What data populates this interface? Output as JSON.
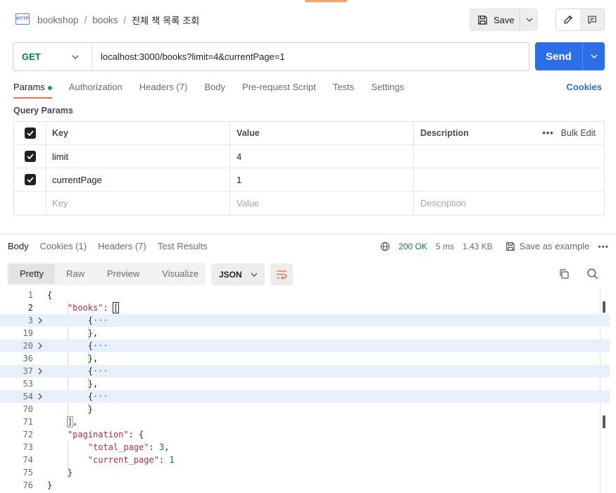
{
  "breadcrumb": {
    "icon_text": "HTTP",
    "items": [
      "bookshop",
      "books"
    ],
    "current": "전체 책 목록 조회"
  },
  "toolbar": {
    "save_label": "Save"
  },
  "request": {
    "method": "GET",
    "url": "localhost:3000/books?limit=4&currentPage=1",
    "send_label": "Send"
  },
  "request_tabs": [
    "Params",
    "Authorization",
    "Headers (7)",
    "Body",
    "Pre-request Script",
    "Tests",
    "Settings"
  ],
  "cookies_label": "Cookies",
  "query_params": {
    "title": "Query Params",
    "headers": {
      "key": "Key",
      "value": "Value",
      "description": "Description",
      "bulk_edit": "Bulk Edit"
    },
    "rows": [
      {
        "key": "limit",
        "value": "4",
        "checked": true
      },
      {
        "key": "currentPage",
        "value": "1",
        "checked": true
      }
    ],
    "placeholders": {
      "key": "Key",
      "value": "Value",
      "description": "Description"
    }
  },
  "response_tabs": [
    "Body",
    "Cookies (1)",
    "Headers (7)",
    "Test Results"
  ],
  "response_meta": {
    "status": "200 OK",
    "time": "5 ms",
    "size": "1.43 KB",
    "save_example": "Save as example"
  },
  "view_tabs": [
    "Pretty",
    "Raw",
    "Preview",
    "Visualize"
  ],
  "format": "JSON",
  "code_lines": [
    {
      "n": "1",
      "text": "{"
    },
    {
      "n": "2",
      "text": "\"books\": ["
    },
    {
      "n": "3",
      "text": "{···"
    },
    {
      "n": "19",
      "text": "},"
    },
    {
      "n": "20",
      "text": "{···"
    },
    {
      "n": "36",
      "text": "},"
    },
    {
      "n": "37",
      "text": "{···"
    },
    {
      "n": "53",
      "text": "},"
    },
    {
      "n": "54",
      "text": "{···"
    },
    {
      "n": "70",
      "text": "}"
    },
    {
      "n": "71",
      "text": "],"
    },
    {
      "n": "72",
      "text": "\"pagination\": {"
    },
    {
      "n": "73",
      "text": "\"total_page\": 3,"
    },
    {
      "n": "74",
      "text": "\"current_page\": 1"
    },
    {
      "n": "75",
      "text": "}"
    },
    {
      "n": "76",
      "text": "}"
    }
  ],
  "colors": {
    "accent": "#ff6c37",
    "send": "#2d6ee6",
    "method_get": "#0c7a43",
    "status_ok": "#0c7a43",
    "highlight_row": "#e8f0fc"
  }
}
